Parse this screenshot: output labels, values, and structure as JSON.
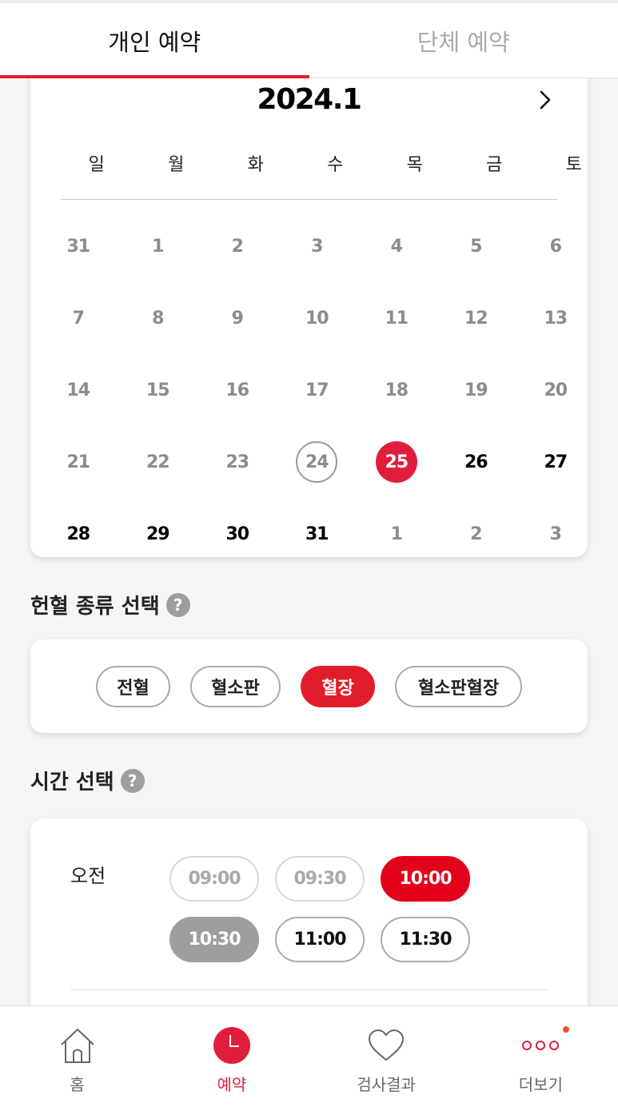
{
  "tabs": [
    {
      "label": "개인 예약",
      "active": true
    },
    {
      "label": "단체 예약",
      "active": false
    }
  ],
  "calendar": {
    "month_title": "2024.1",
    "weekdays": [
      "일",
      "월",
      "화",
      "수",
      "목",
      "금",
      "토"
    ],
    "weeks": [
      [
        "31",
        "1",
        "2",
        "3",
        "4",
        "5",
        "6"
      ],
      [
        "7",
        "8",
        "9",
        "10",
        "11",
        "12",
        "13"
      ],
      [
        "14",
        "15",
        "16",
        "17",
        "18",
        "19",
        "20"
      ],
      [
        "21",
        "22",
        "23",
        "24",
        "25",
        "26",
        "27"
      ],
      [
        "28",
        "29",
        "30",
        "31",
        "1",
        "2",
        "3"
      ]
    ],
    "today": "24",
    "selected": "25"
  },
  "donation_type": {
    "title": "헌혈 종류 선택",
    "help": "?",
    "options": [
      "전혈",
      "혈소판",
      "혈장",
      "혈소판혈장"
    ],
    "selected": "혈장"
  },
  "time_select": {
    "title": "시간 선택",
    "help": "?",
    "period_label": "오전",
    "slots": [
      {
        "time": "09:00",
        "state": "disabled"
      },
      {
        "time": "09:30",
        "state": "disabled"
      },
      {
        "time": "10:00",
        "state": "selected"
      },
      {
        "time": "10:30",
        "state": "closed"
      },
      {
        "time": "11:00",
        "state": "available"
      },
      {
        "time": "11:30",
        "state": "available"
      }
    ]
  },
  "bottom_nav": [
    {
      "label": "홈",
      "icon": "home-icon",
      "active": false
    },
    {
      "label": "예약",
      "icon": "clock-icon",
      "active": true
    },
    {
      "label": "검사결과",
      "icon": "heart-icon",
      "active": false
    },
    {
      "label": "더보기",
      "icon": "more-icon",
      "active": false,
      "badge": true
    }
  ],
  "colors": {
    "accent": "#e01e2b",
    "selected_date": "#e01e3c",
    "badge": "#e8542c",
    "disabled_slot": "#9e9e9e"
  }
}
